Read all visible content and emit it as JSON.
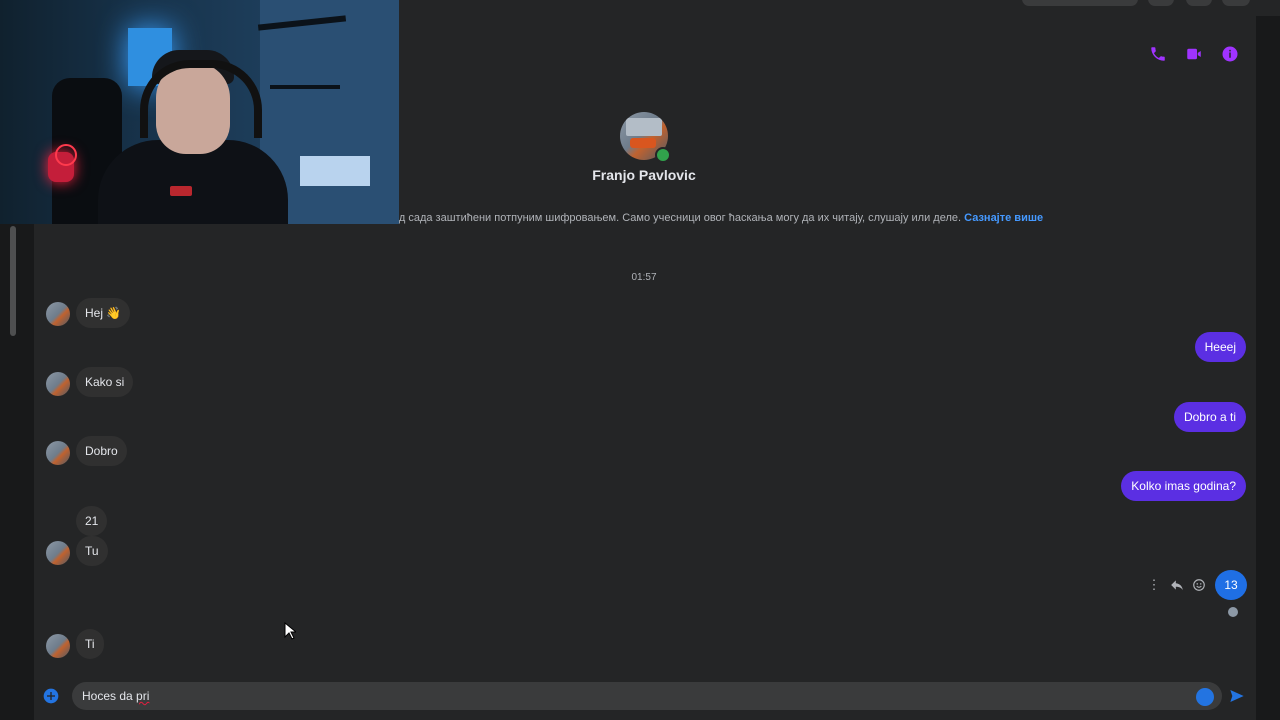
{
  "header": {
    "contact_name": "Franjo Pavlovic",
    "icons": [
      "phone-icon",
      "video-camera-icon",
      "info-icon"
    ],
    "accent_color": "#a033ff"
  },
  "encryption_notice": {
    "text": "од сада заштићени потпуним шифровањем. Само учесници овог ћаскања могу да их читају, слушају или деле.",
    "link": "Сазнајте више"
  },
  "conversation": {
    "timestamp": "01:57",
    "incoming": [
      "Hej 👋",
      "Kako si",
      "Dobro",
      "21",
      "Tu",
      "Ti"
    ],
    "outgoing": [
      "Heeej",
      "Dobro a ti",
      "Kolko imas godina?",
      "13"
    ],
    "colors": {
      "incoming_bubble": "#303030",
      "outgoing_bubble": "#5b2fe3",
      "latest_bubble": "#1f6fe5"
    }
  },
  "message_actions": [
    "more-options-icon",
    "reply-icon",
    "reaction-icon"
  ],
  "composer": {
    "value": "Hoces da pri",
    "value_correct": "Hoces da ",
    "value_misspelled": "pri"
  }
}
